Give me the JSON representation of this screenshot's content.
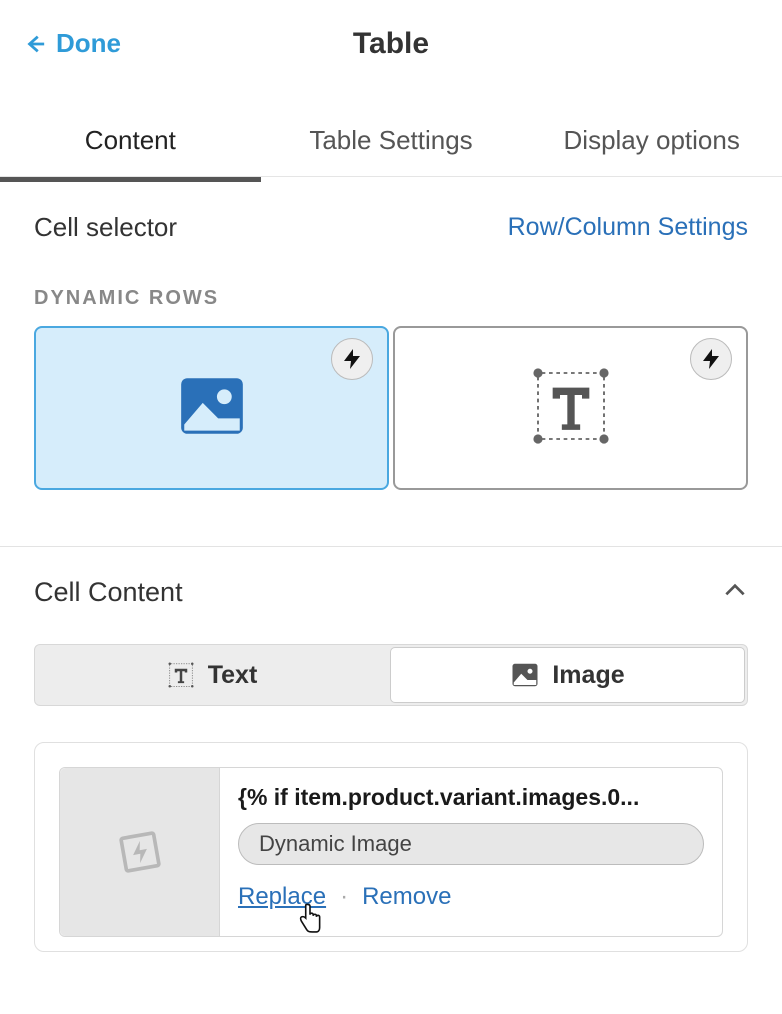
{
  "header": {
    "back_label": "Done",
    "title": "Table"
  },
  "tabs": {
    "content": "Content",
    "settings": "Table Settings",
    "display": "Display options"
  },
  "cellselector": {
    "label": "Cell selector",
    "rowcol_link": "Row/Column Settings",
    "dynamic_rows": "DYNAMIC ROWS"
  },
  "cellcontent": {
    "title": "Cell Content",
    "seg_text": "Text",
    "seg_image": "Image"
  },
  "imagecard": {
    "code": "{% if item.product.variant.images.0...",
    "pill": "Dynamic Image",
    "replace": "Replace",
    "remove": "Remove"
  }
}
